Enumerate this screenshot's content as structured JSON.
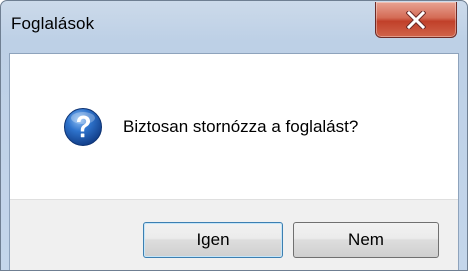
{
  "window": {
    "title": "Foglalások"
  },
  "dialog": {
    "icon": "question-icon",
    "message": "Biztosan stornózza a foglalást?"
  },
  "buttons": {
    "yes_label": "Igen",
    "no_label": "Nem"
  },
  "colors": {
    "close_button": "#c7503a",
    "icon_blue": "#1f5fb5",
    "default_button_border": "#3c7fb1"
  }
}
